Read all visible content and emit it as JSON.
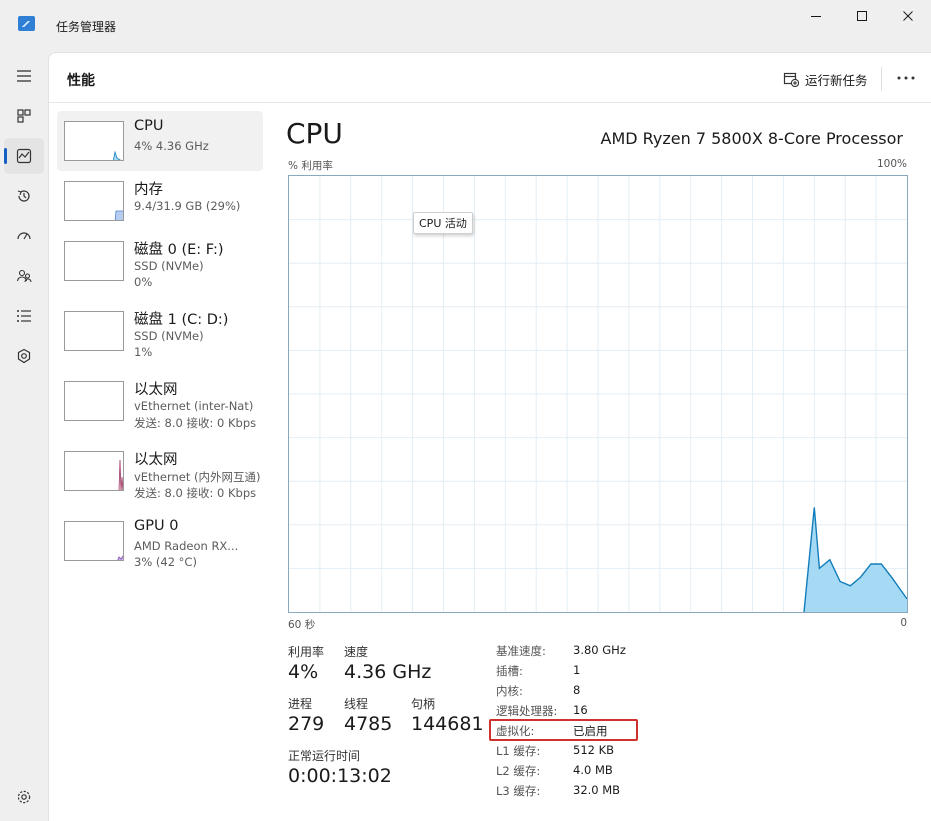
{
  "window": {
    "title": "任务管理器"
  },
  "header": {
    "page_title": "性能",
    "run_new_task_label": "运行新任务"
  },
  "resources": [
    {
      "title": "CPU",
      "line1": "4% 4.36 GHz",
      "line2": ""
    },
    {
      "title": "内存",
      "line1": "9.4/31.9 GB (29%)",
      "line2": ""
    },
    {
      "title": "磁盘 0 (E: F:)",
      "line1": "SSD (NVMe)",
      "line2": "0%"
    },
    {
      "title": "磁盘 1 (C: D:)",
      "line1": "SSD (NVMe)",
      "line2": "1%"
    },
    {
      "title": "以太网",
      "line1": "vEthernet (inter-Nat)",
      "line2": "发送: 8.0 接收: 0 Kbps"
    },
    {
      "title": "以太网",
      "line1": "vEthernet (内外网互通)",
      "line2": "发送: 8.0 接收: 0 Kbps"
    },
    {
      "title": "GPU 0",
      "line1": "AMD Radeon RX...",
      "line2": "3% (42 °C)"
    }
  ],
  "detail": {
    "title": "CPU",
    "model": "AMD Ryzen 7 5800X 8-Core Processor",
    "y_label": "% 利用率",
    "y_max": "100%",
    "x_left": "60 秒",
    "x_right": "0",
    "tooltip": "CPU 活动"
  },
  "chart_data": {
    "type": "area",
    "ylabel": "% 利用率",
    "ylim": [
      0,
      100
    ],
    "x_range_seconds": [
      60,
      0
    ],
    "grid": true,
    "series": [
      {
        "values": [
          [
            10,
            0
          ],
          [
            9,
            24
          ],
          [
            8.5,
            10
          ],
          [
            7.5,
            12
          ],
          [
            6.5,
            7
          ],
          [
            5.5,
            6
          ],
          [
            4.5,
            8
          ],
          [
            3.5,
            11
          ],
          [
            2.5,
            11
          ],
          [
            1.5,
            8
          ],
          [
            0,
            3
          ]
        ]
      }
    ]
  },
  "stats": {
    "utilization_label": "利用率",
    "utilization_value": "4%",
    "speed_label": "速度",
    "speed_value": "4.36 GHz",
    "processes_label": "进程",
    "processes_value": "279",
    "threads_label": "线程",
    "threads_value": "4785",
    "handles_label": "句柄",
    "handles_value": "144681",
    "uptime_label": "正常运行时间",
    "uptime_value": "0:00:13:02"
  },
  "specs": [
    {
      "label": "基准速度:",
      "value": "3.80 GHz"
    },
    {
      "label": "插槽:",
      "value": "1"
    },
    {
      "label": "内核:",
      "value": "8"
    },
    {
      "label": "逻辑处理器:",
      "value": "16"
    },
    {
      "label": "虚拟化:",
      "value": "已启用"
    },
    {
      "label": "L1 缓存:",
      "value": "512 KB"
    },
    {
      "label": "L2 缓存:",
      "value": "4.0 MB"
    },
    {
      "label": "L3 缓存:",
      "value": "32.0 MB"
    }
  ],
  "colors": {
    "accent": "#1560c2",
    "cpu_line": "#117dbb",
    "cpu_fill": "#a6d9f4",
    "highlight": "#d0312d"
  }
}
